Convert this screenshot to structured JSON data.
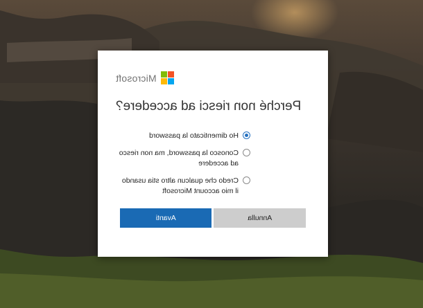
{
  "brand": {
    "name": "Microsoft",
    "colors": [
      "#f35325",
      "#81bc06",
      "#05a6f0",
      "#ffba08"
    ]
  },
  "dialog": {
    "title": "Perché non riesci ad accedere?",
    "options": [
      {
        "label": "Ho dimenticato la password",
        "selected": true
      },
      {
        "label": "Conosco la password, ma non riesco ad accedere",
        "selected": false
      },
      {
        "label": "Credo che qualcun altro stia usando il mio account Microsoft",
        "selected": false
      }
    ],
    "buttons": {
      "cancel": "Annulla",
      "next": "Avanti"
    }
  },
  "colors": {
    "accent": "#1a6ab4",
    "cancel_bg": "#cdcdcd"
  }
}
